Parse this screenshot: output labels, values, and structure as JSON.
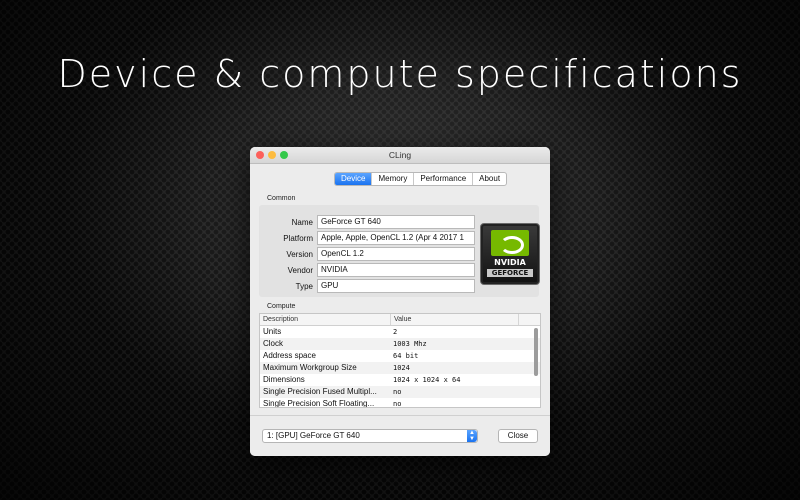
{
  "headline": "Device & compute specifications",
  "window": {
    "title": "CLing",
    "tabs": [
      "Device",
      "Memory",
      "Performance",
      "About"
    ],
    "active_tab": "Device"
  },
  "common": {
    "label": "Common",
    "fields": [
      {
        "label": "Name",
        "value": "GeForce GT 640"
      },
      {
        "label": "Platform",
        "value": "Apple, Apple, OpenCL 1.2 (Apr  4 2017 1"
      },
      {
        "label": "Version",
        "value": "OpenCL 1.2"
      },
      {
        "label": "Vendor",
        "value": "NVIDIA"
      },
      {
        "label": "Type",
        "value": "GPU"
      }
    ],
    "logo": {
      "brand": "NVIDIA",
      "product": "GEFORCE"
    }
  },
  "compute": {
    "label": "Compute",
    "columns": [
      "Description",
      "Value"
    ],
    "rows": [
      {
        "description": "Units",
        "value": "2"
      },
      {
        "description": "Clock",
        "value": "1003 Mhz"
      },
      {
        "description": "Address space",
        "value": "64 bit"
      },
      {
        "description": "Maximum Workgroup Size",
        "value": "1024"
      },
      {
        "description": "Dimensions",
        "value": "1024 x 1024 x 64"
      },
      {
        "description": "Single Precision Fused Multipl...",
        "value": "no"
      },
      {
        "description": "Single Precision Soft Floating...",
        "value": "no"
      }
    ]
  },
  "footer": {
    "device_select": "1: [GPU] GeForce GT 640",
    "close_label": "Close"
  },
  "colors": {
    "accent": "#1a73f0",
    "nvidia_green": "#76b900",
    "close_light": "#fc605b",
    "minimize_light": "#fdbc40",
    "maximize_light": "#34c84a"
  },
  "icons": [
    "close-light-icon",
    "minimize-light-icon",
    "maximize-light-icon",
    "nvidia-logo-icon",
    "select-arrows-icon"
  ]
}
